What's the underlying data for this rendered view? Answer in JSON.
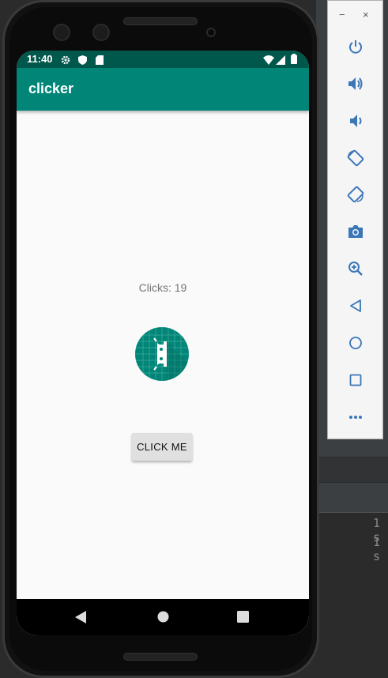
{
  "status_bar": {
    "time": "11:40",
    "icons": [
      "gear-icon",
      "shield-icon",
      "sd-card-icon"
    ],
    "right_icons": [
      "wifi-icon",
      "signal-icon",
      "battery-icon"
    ]
  },
  "app": {
    "title": "clicker",
    "clicks_text": "Clicks: 19",
    "button_label": "CLICK ME",
    "accent_color": "#008577",
    "status_color": "#00574b"
  },
  "nav": {
    "back": "back-icon",
    "home": "home-icon",
    "recents": "recents-icon"
  },
  "emulator_panel": {
    "window_controls": [
      "−",
      "×"
    ],
    "buttons": [
      "power-icon",
      "volume-up-icon",
      "volume-down-icon",
      "rotate-left-icon",
      "rotate-right-icon",
      "camera-icon",
      "zoom-icon",
      "back-icon",
      "home-icon",
      "overview-icon",
      "more-icon"
    ]
  },
  "ide": {
    "log_lines": [
      "1 s",
      "1 s"
    ]
  }
}
